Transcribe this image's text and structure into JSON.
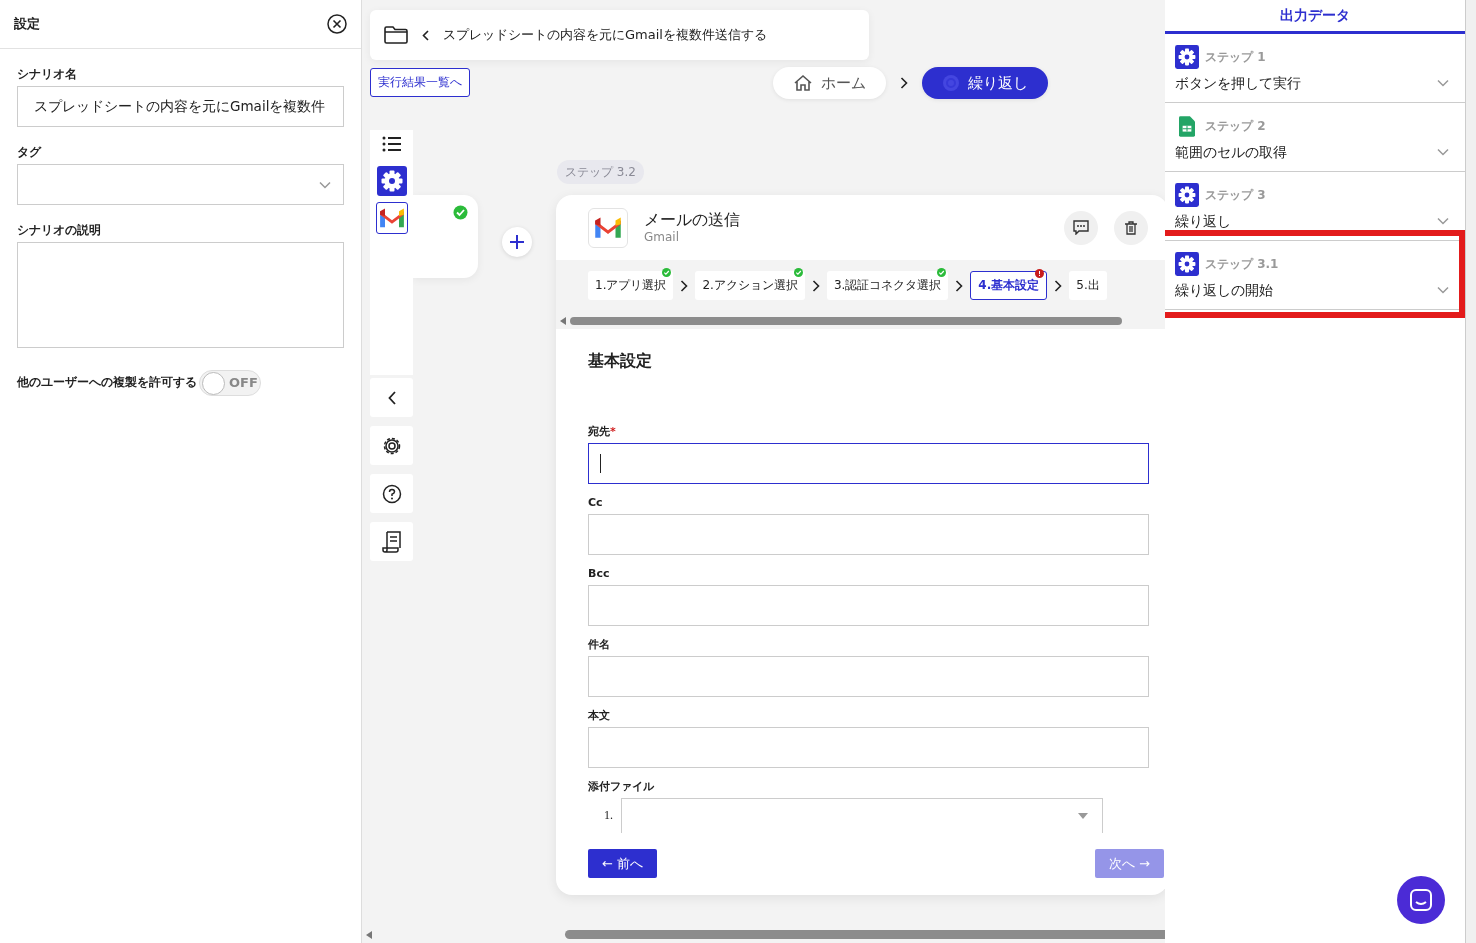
{
  "settings_panel": {
    "title": "設定",
    "fields": [
      {
        "kind": "text",
        "label": "シナリオ名",
        "value": "スプレッドシートの内容を元にGmailを複数件"
      },
      {
        "kind": "select",
        "label": "タグ"
      },
      {
        "kind": "textarea",
        "label": "シナリオの説明"
      }
    ],
    "toggle": {
      "label": "他のユーザーへの複製を許可する",
      "on": false,
      "text": "OFF"
    }
  },
  "breadcrumb": {
    "title": "スプレッドシートの内容を元にGmailを複数件送信する"
  },
  "results_link": "実行結果一覧へ",
  "path": [
    {
      "label": "ホーム",
      "selected": false
    },
    {
      "label": "繰り返し",
      "selected": true
    }
  ],
  "step_badge": "ステップ 3.2",
  "action_card": {
    "title": "メールの送信",
    "app": "Gmail",
    "tabs": [
      {
        "label": "1.アプリ選択",
        "completed": true,
        "error": false,
        "selected": false
      },
      {
        "label": "2.アクション選択",
        "completed": true,
        "error": false,
        "selected": false
      },
      {
        "label": "3.認証コネクタ選択",
        "completed": true,
        "error": false,
        "selected": false
      },
      {
        "label": "4.基本設定",
        "completed": false,
        "error": true,
        "selected": true
      },
      {
        "label": "5.出",
        "completed": false,
        "error": false,
        "selected": false
      }
    ],
    "section_title": "基本設定",
    "fields": [
      {
        "kind": "text",
        "label": "宛先",
        "required": "*",
        "focused": true
      },
      {
        "kind": "text",
        "label": "Cc",
        "focused": false
      },
      {
        "kind": "text",
        "label": "Bcc",
        "focused": false
      },
      {
        "kind": "text",
        "label": "件名",
        "focused": false
      },
      {
        "kind": "text",
        "label": "本文",
        "focused": false
      },
      {
        "kind": "file",
        "label": "添付ファイル",
        "index": "1."
      }
    ],
    "prev_button": {
      "label": "← 前へ",
      "disabled": false
    },
    "next_button": {
      "label": "次へ →",
      "disabled": true
    }
  },
  "output_panel": {
    "title": "出力データ",
    "steps": [
      {
        "kind": "gear",
        "step": "ステップ 1",
        "name": "ボタンを押して実行",
        "highlighted": false
      },
      {
        "kind": "sheet",
        "step": "ステップ 2",
        "name": "範囲のセルの取得",
        "highlighted": false
      },
      {
        "kind": "gear",
        "step": "ステップ 3",
        "name": "繰り返し",
        "highlighted": false
      },
      {
        "kind": "gear",
        "step": "ステップ 3.1",
        "name": "繰り返しの開始",
        "highlighted": true
      }
    ]
  }
}
